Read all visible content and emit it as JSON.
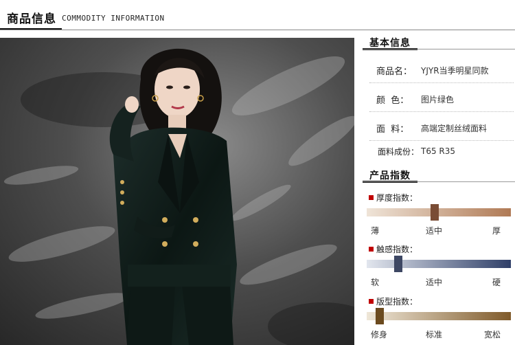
{
  "header": {
    "title": "商品信息",
    "subtitle": "COMMODITY INFORMATION"
  },
  "photo": {
    "description_icon": "model-photo-icon"
  },
  "basic_info": {
    "title": "基本信息",
    "rows": [
      {
        "label": "商品名：",
        "value": "YJYR当季明星同款"
      },
      {
        "label": "颜  色：",
        "value": "图片绿色"
      },
      {
        "label": "面  料：",
        "value": "高端定制丝绒面料"
      },
      {
        "label": "面料成份：",
        "value": "T65 R35"
      }
    ]
  },
  "product_index": {
    "title": "产品指数",
    "indexes": [
      {
        "name": "厚度指数：",
        "ticks": [
          "薄",
          "适中",
          "厚"
        ],
        "level": 0.47,
        "gradient": [
          "#efe4d8",
          "#b07a55"
        ],
        "knob_color": "#7a4c35"
      },
      {
        "name": "触感指数：",
        "ticks": [
          "软",
          "适中",
          "硬"
        ],
        "level": 0.22,
        "gradient": [
          "#e2e6ee",
          "#2f3f68"
        ],
        "knob_color": "#3d4763"
      },
      {
        "name": "版型指数：",
        "ticks": [
          "修身",
          "标准",
          "宽松"
        ],
        "level": 0.09,
        "gradient": [
          "#efe7d8",
          "#7f5a2a"
        ],
        "knob_color": "#6b4a1e"
      }
    ]
  },
  "colors": {
    "accent": "#c00000",
    "text_dark": "#111111"
  }
}
